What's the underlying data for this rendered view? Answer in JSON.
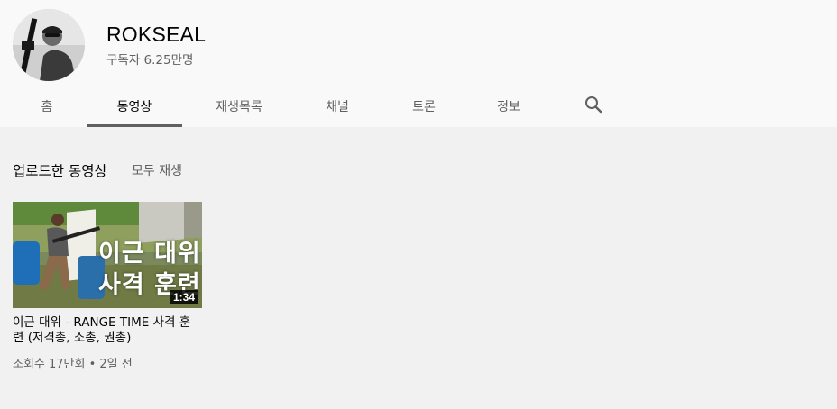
{
  "channel": {
    "name": "ROKSEAL",
    "subscribers": "구독자 6.25만명"
  },
  "tabs": [
    {
      "label": "홈"
    },
    {
      "label": "동영상",
      "active": true
    },
    {
      "label": "재생목록"
    },
    {
      "label": "채널"
    },
    {
      "label": "토론"
    },
    {
      "label": "정보"
    }
  ],
  "search_icon": "search-icon",
  "section": {
    "title": "업로드한 동영상",
    "play_all": "모두 재생"
  },
  "videos": [
    {
      "thumb_text_line1": "이근 대위",
      "thumb_text_line2": "사격 훈련",
      "duration": "1:34",
      "title": "이근 대위 - RANGE TIME 사격 훈련 (저격총, 소총, 권총)",
      "meta": "조회수 17만회 • 2일 전"
    }
  ],
  "colors": {
    "header_bg": "#f9f9f9",
    "page_bg": "#f1f1f1",
    "text_primary": "#030303",
    "text_secondary": "#606060"
  }
}
